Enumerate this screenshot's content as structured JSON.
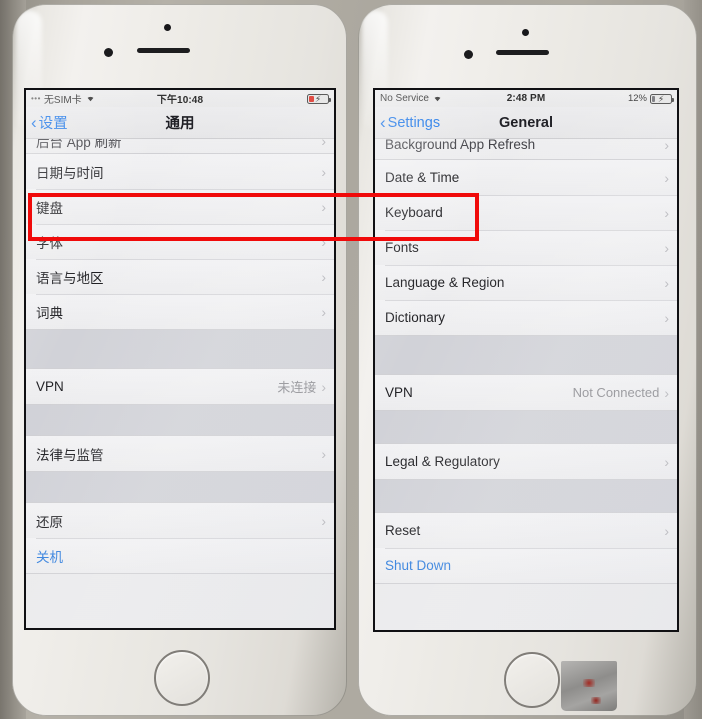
{
  "scene": {
    "description": "Photo of two iPhones side by side showing the iOS General settings screen, Chinese on the left and English on the right, with a red annotation rectangle drawn across the Date & Time row on both phones",
    "background_color": "#a9a49b",
    "annotation": {
      "name": "red-highlight-rectangle",
      "color": "#f00a0a",
      "targets": [
        "日期与时间",
        "Date & Time"
      ]
    }
  },
  "left_phone": {
    "name": "iphone-chinese",
    "status_bar": {
      "carrier": "无SIM卡",
      "wifi_icon": "wifi-icon",
      "time": "下午10:48",
      "battery_percent": "",
      "battery_icon": "battery-charging-icon",
      "battery_color": "#e02b22"
    },
    "nav": {
      "back_label": "设置",
      "back_icon": "chevron-left-icon",
      "title": "通用"
    },
    "cut_row_label": "后台 App 刷新",
    "groups": [
      {
        "rows": [
          {
            "label": "日期与时间",
            "value": "",
            "accessory": "chevron-right-icon",
            "style": "normal"
          },
          {
            "label": "键盘",
            "value": "",
            "accessory": "chevron-right-icon",
            "style": "normal"
          },
          {
            "label": "字体",
            "value": "",
            "accessory": "chevron-right-icon",
            "style": "normal"
          },
          {
            "label": "语言与地区",
            "value": "",
            "accessory": "chevron-right-icon",
            "style": "normal"
          },
          {
            "label": "词典",
            "value": "",
            "accessory": "chevron-right-icon",
            "style": "normal"
          }
        ]
      },
      {
        "rows": [
          {
            "label": "VPN",
            "value": "未连接",
            "accessory": "chevron-right-icon",
            "style": "normal"
          }
        ]
      },
      {
        "rows": [
          {
            "label": "法律与监管",
            "value": "",
            "accessory": "chevron-right-icon",
            "style": "normal"
          }
        ]
      },
      {
        "rows": [
          {
            "label": "还原",
            "value": "",
            "accessory": "chevron-right-icon",
            "style": "normal"
          },
          {
            "label": "关机",
            "value": "",
            "accessory": "",
            "style": "blue"
          }
        ]
      }
    ]
  },
  "right_phone": {
    "name": "iphone-english",
    "status_bar": {
      "carrier": "No Service",
      "wifi_icon": "wifi-icon",
      "time": "2:48 PM",
      "battery_percent": "12%",
      "battery_icon": "battery-charging-icon",
      "battery_color": "#6d6d72"
    },
    "nav": {
      "back_label": "Settings",
      "back_icon": "chevron-left-icon",
      "title": "General"
    },
    "cut_row_label": "Background App Refresh",
    "groups": [
      {
        "rows": [
          {
            "label": "Date & Time",
            "value": "",
            "accessory": "chevron-right-icon",
            "style": "normal"
          },
          {
            "label": "Keyboard",
            "value": "",
            "accessory": "chevron-right-icon",
            "style": "normal"
          },
          {
            "label": "Fonts",
            "value": "",
            "accessory": "chevron-right-icon",
            "style": "normal"
          },
          {
            "label": "Language & Region",
            "value": "",
            "accessory": "chevron-right-icon",
            "style": "normal"
          },
          {
            "label": "Dictionary",
            "value": "",
            "accessory": "chevron-right-icon",
            "style": "normal"
          }
        ]
      },
      {
        "rows": [
          {
            "label": "VPN",
            "value": "Not Connected",
            "accessory": "chevron-right-icon",
            "style": "normal"
          }
        ]
      },
      {
        "rows": [
          {
            "label": "Legal & Regulatory",
            "value": "",
            "accessory": "chevron-right-icon",
            "style": "normal"
          }
        ]
      },
      {
        "rows": [
          {
            "label": "Reset",
            "value": "",
            "accessory": "chevron-right-icon",
            "style": "normal"
          },
          {
            "label": "Shut Down",
            "value": "",
            "accessory": "",
            "style": "blue"
          }
        ]
      }
    ]
  },
  "glyphs": {
    "chevron_right": "›",
    "chevron_left": "‹",
    "wifi": "▲",
    "bolt": "⚡"
  }
}
